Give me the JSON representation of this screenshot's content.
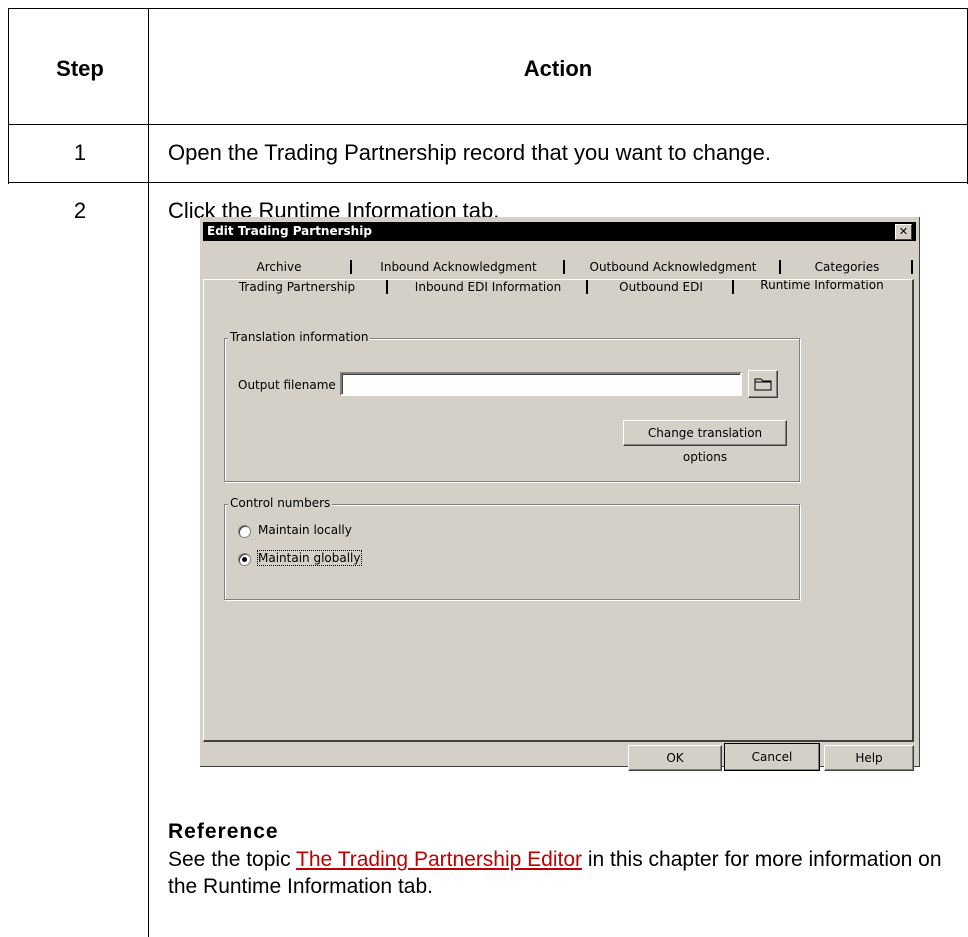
{
  "table": {
    "header_step": "Step",
    "header_action": "Action",
    "rows": [
      {
        "step": "1",
        "action": "Open the Trading Partnership record that you want to change."
      },
      {
        "step": "2",
        "action": "Click the Runtime Information tab."
      }
    ]
  },
  "dialog": {
    "title": "Edit Trading Partnership",
    "close_glyph": "✕",
    "tabs_back": [
      "Archive",
      "Inbound Acknowledgment",
      "Outbound Acknowledgment",
      "Categories"
    ],
    "tabs_front": [
      "Trading Partnership",
      "Inbound EDI Information",
      "Outbound EDI",
      "Runtime Information"
    ],
    "active_tab": "Runtime Information",
    "translation_group": "Translation information",
    "output_filename_label": "Output filename",
    "output_filename_value": "",
    "change_translation_button": "Change translation options",
    "control_numbers_group": "Control numbers",
    "radio_local": "Maintain locally",
    "radio_global": "Maintain globally",
    "selected_radio": "global",
    "ok_button": "OK",
    "cancel_button": "Cancel",
    "help_button": "Help"
  },
  "reference": {
    "title": "Reference",
    "text_before": "See the topic ",
    "link_text": "The Trading Partnership Editor",
    "text_after": " in this chapter for more information on the Runtime Information tab."
  }
}
